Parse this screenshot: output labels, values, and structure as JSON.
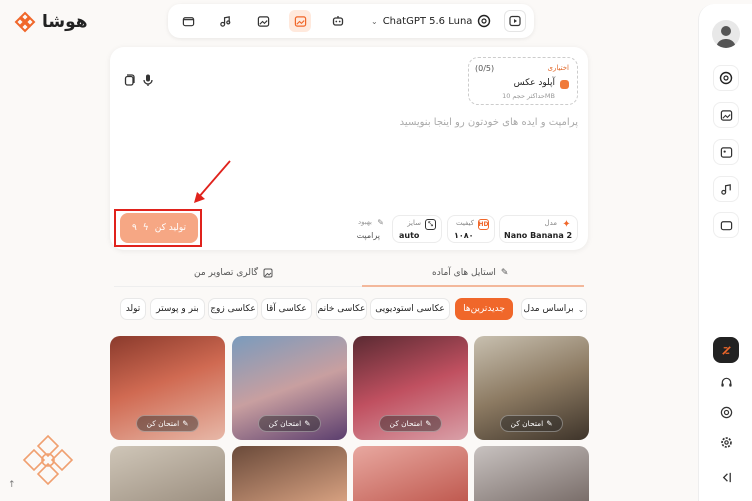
{
  "brand": {
    "name": "هوشا",
    "color": "#f0672a"
  },
  "topbar": {
    "model_name": "ChatGPT 5.6 Luna",
    "icons": [
      "folder-icon",
      "music-note-icon",
      "image-gallery-icon",
      "image-edit-icon",
      "robot-icon"
    ],
    "active_icon": "image-edit-icon"
  },
  "composer": {
    "upload": {
      "optional": "اختیاری",
      "count": "(0/5)",
      "title": "آپلود عکس",
      "subtitle": "حداکثر حجم 10MB"
    },
    "placeholder": "پرامپت و ایده های خودتون رو اینجا بنویسید",
    "generate": {
      "label": "تولید کن",
      "cost": "۹"
    },
    "options": {
      "model": {
        "label": "مدل",
        "value": "Nano Banana 2"
      },
      "quality": {
        "label": "کیفیت",
        "value": "۱۰۸۰",
        "badge": "HD"
      },
      "size": {
        "label": "سایز",
        "value": "auto"
      },
      "enhance": {
        "label": "بهبود",
        "value": "پرامپت"
      }
    }
  },
  "tabs": [
    {
      "label": "استایل های آماده",
      "active": true
    },
    {
      "label": "گالری تصاویر من",
      "active": false
    }
  ],
  "filter": {
    "sort_label": "براساس مدل"
  },
  "categories": [
    {
      "label": "جدیدترین‌ها",
      "active": true
    },
    {
      "label": "عکاسی استودیویی",
      "active": false
    },
    {
      "label": "عکاسی خانم",
      "active": false
    },
    {
      "label": "عکاسی آقا",
      "active": false
    },
    {
      "label": "عکاسی زوج",
      "active": false
    },
    {
      "label": "بنر و پوستر",
      "active": false
    },
    {
      "label": "تولد",
      "active": false
    }
  ],
  "cards": {
    "try_label": "امتحان کن"
  }
}
